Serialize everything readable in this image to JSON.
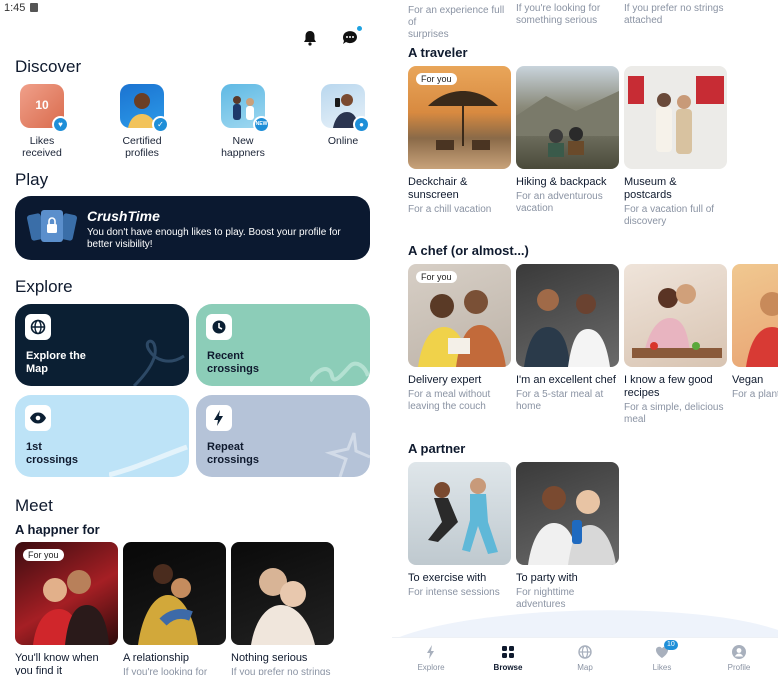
{
  "status": {
    "time": "1:45"
  },
  "left": {
    "discover_title": "Discover",
    "discover": [
      {
        "label": "Likes\nreceived",
        "count": "10",
        "badge": "heart-icon"
      },
      {
        "label": "Certified\nprofiles",
        "badge": "check-icon"
      },
      {
        "label": "New\nhappners",
        "badge": "new-icon",
        "badge_text": "NEW"
      },
      {
        "label": "Online",
        "badge": "dot-icon"
      }
    ],
    "play_title": "Play",
    "crushtime": {
      "title": "CrushTime",
      "text": "You don't have enough likes to play. Boost your profile for better visibility!"
    },
    "explore_title": "Explore",
    "tiles": [
      {
        "label": "Explore the\nMap",
        "icon": "globe-icon",
        "color": "#0b1f33",
        "text_color": "#ffffff"
      },
      {
        "label": "Recent\ncrossings",
        "icon": "clock-icon",
        "color": "#8ccdb8",
        "text_color": "#0f1a2e"
      },
      {
        "label": "1st\ncrossings",
        "icon": "eye-icon",
        "color": "#bde3f7",
        "text_color": "#0f1a2e"
      },
      {
        "label": "Repeat\ncrossings",
        "icon": "bolt-icon",
        "color": "#b5c3d8",
        "text_color": "#0f1a2e"
      }
    ],
    "meet_title": "Meet",
    "happner_for": "A happner for",
    "meet_cards": [
      {
        "title": "You'll know when\nyou find it",
        "sub": "",
        "for_you": "For you"
      },
      {
        "title": "A relationship",
        "sub": "If you're looking for"
      },
      {
        "title": "Nothing serious",
        "sub": "If you prefer no strings"
      }
    ]
  },
  "right": {
    "top_clip": [
      "For an experience full of\nsurprises",
      "If you're looking for\nsomething serious",
      "If you prefer no strings\nattached"
    ],
    "sections": [
      {
        "title": "A traveler",
        "cards": [
          {
            "title": "Deckchair &\nsunscreen",
            "sub": "For a chill vacation",
            "for_you": "For you"
          },
          {
            "title": "Hiking & backpack",
            "sub": "For an adventurous\nvacation"
          },
          {
            "title": "Museum &\npostcards",
            "sub": "For a vacation full of\ndiscovery"
          }
        ]
      },
      {
        "title": "A chef (or almost...)",
        "cards": [
          {
            "title": "Delivery expert",
            "sub": "For a meal without\nleaving the couch",
            "for_you": "For you"
          },
          {
            "title": "I'm an excellent chef",
            "sub": "For a 5-star meal at\nhome"
          },
          {
            "title": "I know a few good\nrecipes",
            "sub": "For a simple, delicious\nmeal"
          },
          {
            "title": "Vegan",
            "sub": "For a plant-"
          }
        ]
      },
      {
        "title": "A partner",
        "cards": [
          {
            "title": "To exercise with",
            "sub": "For intense sessions"
          },
          {
            "title": "To party with",
            "sub": "For nighttime\nadventures"
          }
        ]
      }
    ]
  },
  "nav": [
    {
      "label": "Explore",
      "icon": "bolt-icon",
      "active": false
    },
    {
      "label": "Browse",
      "icon": "grid-icon",
      "active": true
    },
    {
      "label": "Map",
      "icon": "globe-icon",
      "active": false
    },
    {
      "label": "Likes",
      "icon": "heart-icon",
      "active": false,
      "badge": "10"
    },
    {
      "label": "Profile",
      "icon": "user-icon",
      "active": false
    }
  ],
  "colors": {
    "accent": "#1f8fd8",
    "dark": "#0b1930"
  }
}
